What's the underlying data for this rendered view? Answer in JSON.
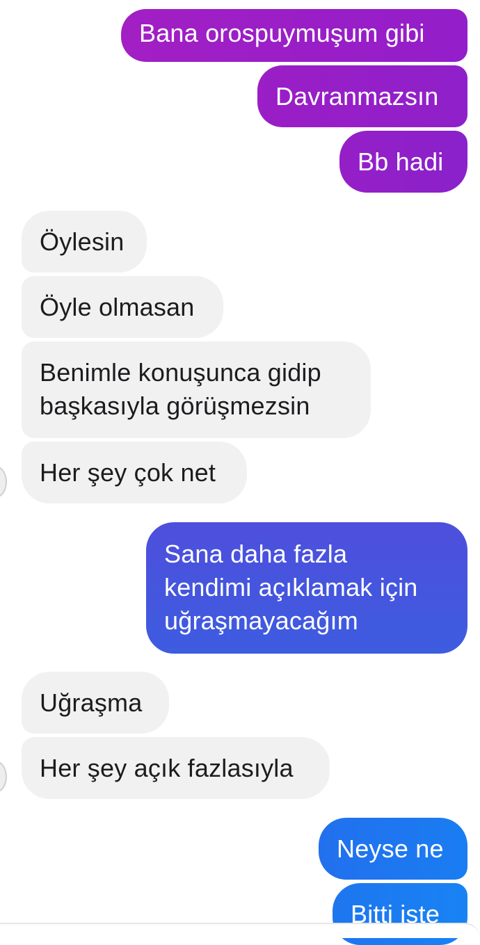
{
  "messages": [
    {
      "direction": "out",
      "text": "Bana orospuymuşum gibi",
      "color": "#9b1ec6"
    },
    {
      "direction": "out",
      "text": "Davranmazsın",
      "color": "#961ec8"
    },
    {
      "direction": "out",
      "text": "Bb hadi",
      "color": "#8f20c9"
    },
    {
      "direction": "in",
      "text": "Öylesin"
    },
    {
      "direction": "in",
      "text": "Öyle olmasan"
    },
    {
      "direction": "in",
      "text": "Benimle konuşunca gidip\nbaşkasıyla görüşmezsin"
    },
    {
      "direction": "in",
      "text": "Her şey çok net"
    },
    {
      "direction": "out",
      "text": "Sana daha fazla\nkendimi açıklamak için\nuğraşmayacağım",
      "color": "#4454de"
    },
    {
      "direction": "in",
      "text": "Uğraşma"
    },
    {
      "direction": "in",
      "text": "Her şey açık fazlasıyla"
    },
    {
      "direction": "out",
      "text": "Neyse ne",
      "color": "#1f78ef"
    },
    {
      "direction": "out",
      "text": "Bitti işte",
      "color": "#1b7cf2"
    }
  ],
  "colors": {
    "incoming_bubble": "#f1f1f2",
    "incoming_text": "#1c1c1e",
    "outgoing_text": "#ffffff"
  }
}
